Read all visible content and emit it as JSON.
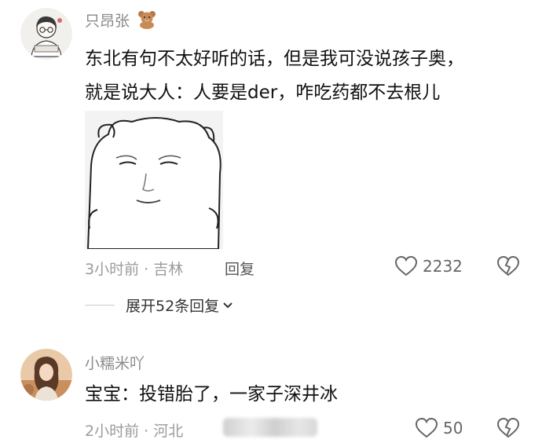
{
  "comments": [
    {
      "username": "只昂张",
      "badge_icon": "teddy-bear-icon",
      "text_lines": [
        "东北有句不太好听的话，但是我可没说孩子奥，",
        "就是说大人：人要是der，咋吃药都不去根儿"
      ],
      "has_sticker": true,
      "time_location": "3小时前 · 吉林",
      "reply_label": "回复",
      "likes": "2232"
    },
    {
      "username": "小糯米吖",
      "text_lines": [
        "宝宝：投错胎了，一家子深井冰"
      ],
      "time_location": "2小时前 · 河北",
      "likes": "50"
    }
  ],
  "expand_replies": "展开52条回复",
  "colors": {
    "username": "#8a8a8a",
    "meta": "#9b9b9b",
    "text": "#111111"
  }
}
